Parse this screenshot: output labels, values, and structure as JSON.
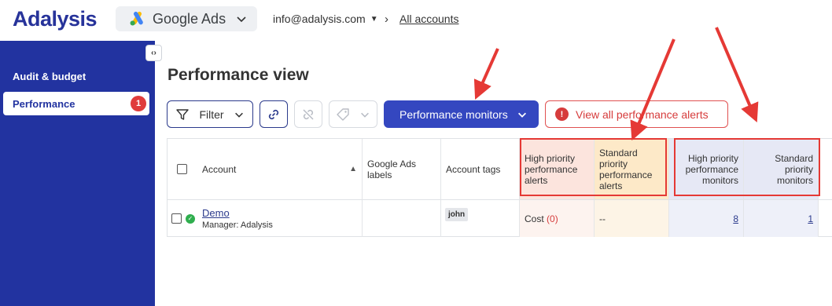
{
  "brand": {
    "logo": "Adalysis"
  },
  "platform": {
    "name": "Google Ads"
  },
  "account": {
    "email": "info@adalysis.com",
    "all_accounts": "All accounts"
  },
  "sidebar": {
    "collapse_icon": "‹›",
    "section": "Audit & budget",
    "items": [
      {
        "label": "Performance",
        "badge": "1"
      }
    ]
  },
  "page": {
    "title": "Performance view"
  },
  "toolbar": {
    "filter_label": "Filter",
    "monitors_label": "Performance monitors",
    "alerts_label": "View all performance alerts",
    "alerts_icon": "!"
  },
  "table": {
    "headers": {
      "account": "Account",
      "labels": "Google Ads labels",
      "tags": "Account tags",
      "high_alerts": "High priority performance alerts",
      "std_alerts": "Standard priority performance alerts",
      "high_monitors": "High priority performance monitors",
      "std_monitors": "Standard priority monitors"
    },
    "rows": [
      {
        "name": "Demo",
        "manager": "Manager: Adalysis",
        "labels": "",
        "tag": "john",
        "high_alerts_text": "Cost",
        "high_alerts_count": "(0)",
        "std_alerts": "--",
        "high_monitors": "8",
        "std_monitors": "1"
      }
    ]
  },
  "colors": {
    "sidebar": "#2233a0",
    "primary": "#3447c0",
    "alert": "#d63c3c",
    "annotation": "#e53935"
  }
}
